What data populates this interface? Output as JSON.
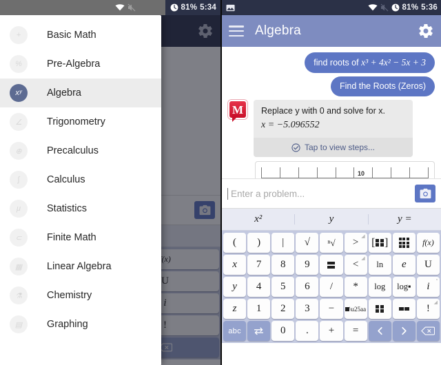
{
  "left": {
    "statusbar": {
      "battery": "81%",
      "time": "5:34",
      "wifi_icon": "wifi-icon",
      "muted_icon": "volume-muted-icon",
      "alarm_icon": "alarm-clock-icon"
    },
    "appbar": {
      "title": "",
      "menu_icon": "hamburger-menu-icon",
      "gear_icon": "gear-icon"
    },
    "drawer": {
      "items": [
        {
          "label": "Basic Math",
          "icon": "basic-math-icon",
          "glyph": "+",
          "active": false
        },
        {
          "label": "Pre-Algebra",
          "icon": "pre-algebra-icon",
          "glyph": "%",
          "active": false
        },
        {
          "label": "Algebra",
          "icon": "algebra-icon",
          "glyph": "xʸ",
          "active": true
        },
        {
          "label": "Trigonometry",
          "icon": "trigonometry-icon",
          "glyph": "∠",
          "active": false
        },
        {
          "label": "Precalculus",
          "icon": "precalculus-icon",
          "glyph": "⊕",
          "active": false
        },
        {
          "label": "Calculus",
          "icon": "calculus-icon",
          "glyph": "∫",
          "active": false
        },
        {
          "label": "Statistics",
          "icon": "statistics-icon",
          "glyph": "μ",
          "active": false
        },
        {
          "label": "Finite Math",
          "icon": "finite-math-icon",
          "glyph": "⊂",
          "active": false
        },
        {
          "label": "Linear Algebra",
          "icon": "linear-algebra-icon",
          "glyph": "▦",
          "active": false
        },
        {
          "label": "Chemistry",
          "icon": "chemistry-icon",
          "glyph": "⚗",
          "active": false
        },
        {
          "label": "Graphing",
          "icon": "graphing-icon",
          "glyph": "▤",
          "active": false
        }
      ]
    },
    "camera_icon": "camera-icon",
    "suggest": [
      "y ="
    ]
  },
  "right": {
    "statusbar": {
      "battery": "81%",
      "time": "5:36",
      "gallery_icon": "gallery-image-icon",
      "wifi_icon": "wifi-icon",
      "muted_icon": "volume-muted-icon",
      "alarm_icon": "alarm-clock-icon"
    },
    "appbar": {
      "title": "Algebra",
      "menu_icon": "hamburger-menu-icon",
      "gear_icon": "gear-icon"
    },
    "chat": {
      "user_query_prefix": "find roots of ",
      "user_query_expr": "x³ + 4x² − 5x + 3",
      "user_action": "Find the Roots (Zeros)",
      "bot_logo": "mathway-logo-icon",
      "bot_instruction": "Replace y with 0 and solve for x.",
      "bot_answer": "x = −5.096552",
      "steps_label": "Tap to view steps...",
      "steps_icon": "check-circle-icon",
      "table_mark": "10"
    },
    "input": {
      "placeholder": "Enter a problem...",
      "value": "",
      "camera_icon": "camera-icon"
    },
    "suggest": [
      "x²",
      "y",
      "y ="
    ],
    "keyboard": {
      "rows": [
        [
          {
            "label": "(",
            "type": "glyph",
            "style": "serif"
          },
          {
            "label": ")",
            "type": "glyph",
            "style": "serif"
          },
          {
            "label": "|",
            "type": "glyph",
            "style": "serif"
          },
          {
            "label": "√",
            "type": "glyph",
            "style": "serif"
          },
          {
            "label": "ⁿ√",
            "type": "nthroot",
            "style": "serif"
          },
          {
            "label": ">",
            "type": "glyph",
            "style": "serif",
            "corner": "◢"
          },
          {
            "label": "bracket-matrix-icon",
            "type": "icon-bracket-matrix"
          },
          {
            "label": "matrix-3x3-icon",
            "type": "icon-matrix3"
          },
          {
            "label": "f(x)",
            "type": "func",
            "style": "italic"
          }
        ],
        [
          {
            "label": "x",
            "type": "var",
            "style": "italic"
          },
          {
            "label": "7",
            "type": "num"
          },
          {
            "label": "8",
            "type": "num"
          },
          {
            "label": "9",
            "type": "num"
          },
          {
            "label": "fraction-icon",
            "type": "icon-fraction"
          },
          {
            "label": "<",
            "type": "glyph",
            "style": "serif",
            "corner": "◢"
          },
          {
            "label": "ln",
            "type": "fn",
            "style": "serif"
          },
          {
            "label": "e",
            "type": "var",
            "style": "italic"
          },
          {
            "label": "U",
            "type": "glyph",
            "style": "serif"
          }
        ],
        [
          {
            "label": "y",
            "type": "var",
            "style": "italic"
          },
          {
            "label": "4",
            "type": "num"
          },
          {
            "label": "5",
            "type": "num"
          },
          {
            "label": "6",
            "type": "num"
          },
          {
            "label": "/",
            "type": "glyph",
            "style": "serif"
          },
          {
            "label": "*",
            "type": "glyph",
            "style": "serif"
          },
          {
            "label": "log",
            "type": "fn",
            "style": "serif"
          },
          {
            "label": "log▪",
            "type": "logsub",
            "style": "serif"
          },
          {
            "label": "i",
            "type": "var",
            "style": "italic",
            "corner": "ⁿ"
          }
        ],
        [
          {
            "label": "z",
            "type": "var",
            "style": "italic"
          },
          {
            "label": "1",
            "type": "num"
          },
          {
            "label": "2",
            "type": "num"
          },
          {
            "label": "3",
            "type": "num"
          },
          {
            "label": "−",
            "type": "glyph",
            "style": "serif"
          },
          {
            "label": "power-icon",
            "type": "icon-power"
          },
          {
            "label": "matrix-block-icon",
            "type": "icon-block2"
          },
          {
            "label": "row-vector-icon",
            "type": "icon-rowvec"
          },
          {
            "label": "!",
            "type": "glyph",
            "style": "serif",
            "corner": "◢"
          }
        ],
        [
          {
            "label": "abc",
            "type": "abc",
            "accent": true
          },
          {
            "label": "swap-keyboard-icon",
            "type": "icon-swap",
            "accent": true
          },
          {
            "label": "0",
            "type": "num"
          },
          {
            "label": ".",
            "type": "glyph",
            "style": "serif"
          },
          {
            "label": "+",
            "type": "glyph",
            "style": "serif"
          },
          {
            "label": "=",
            "type": "glyph",
            "style": "serif"
          },
          {
            "label": "cursor-left-icon",
            "type": "icon-left",
            "accent": true
          },
          {
            "label": "cursor-right-icon",
            "type": "icon-right",
            "accent": true
          },
          {
            "label": "backspace-icon",
            "type": "icon-backspace",
            "accent": true
          }
        ]
      ]
    }
  },
  "colors": {
    "appbar": "#7e8cc0",
    "appbar_dim": "#2f3551",
    "statusbar": "#2b3147",
    "statusbar_light": "#6e6e6e",
    "user_bubble": "#5d76c4",
    "bot_card": "#eaeaea",
    "keyboard_bg": "#c3c9e0",
    "key_accent": "#94a2cd",
    "logo_red": "#c9102a",
    "drawer_active": "#ececec",
    "drawer_icon_active": "#5d6b92"
  }
}
